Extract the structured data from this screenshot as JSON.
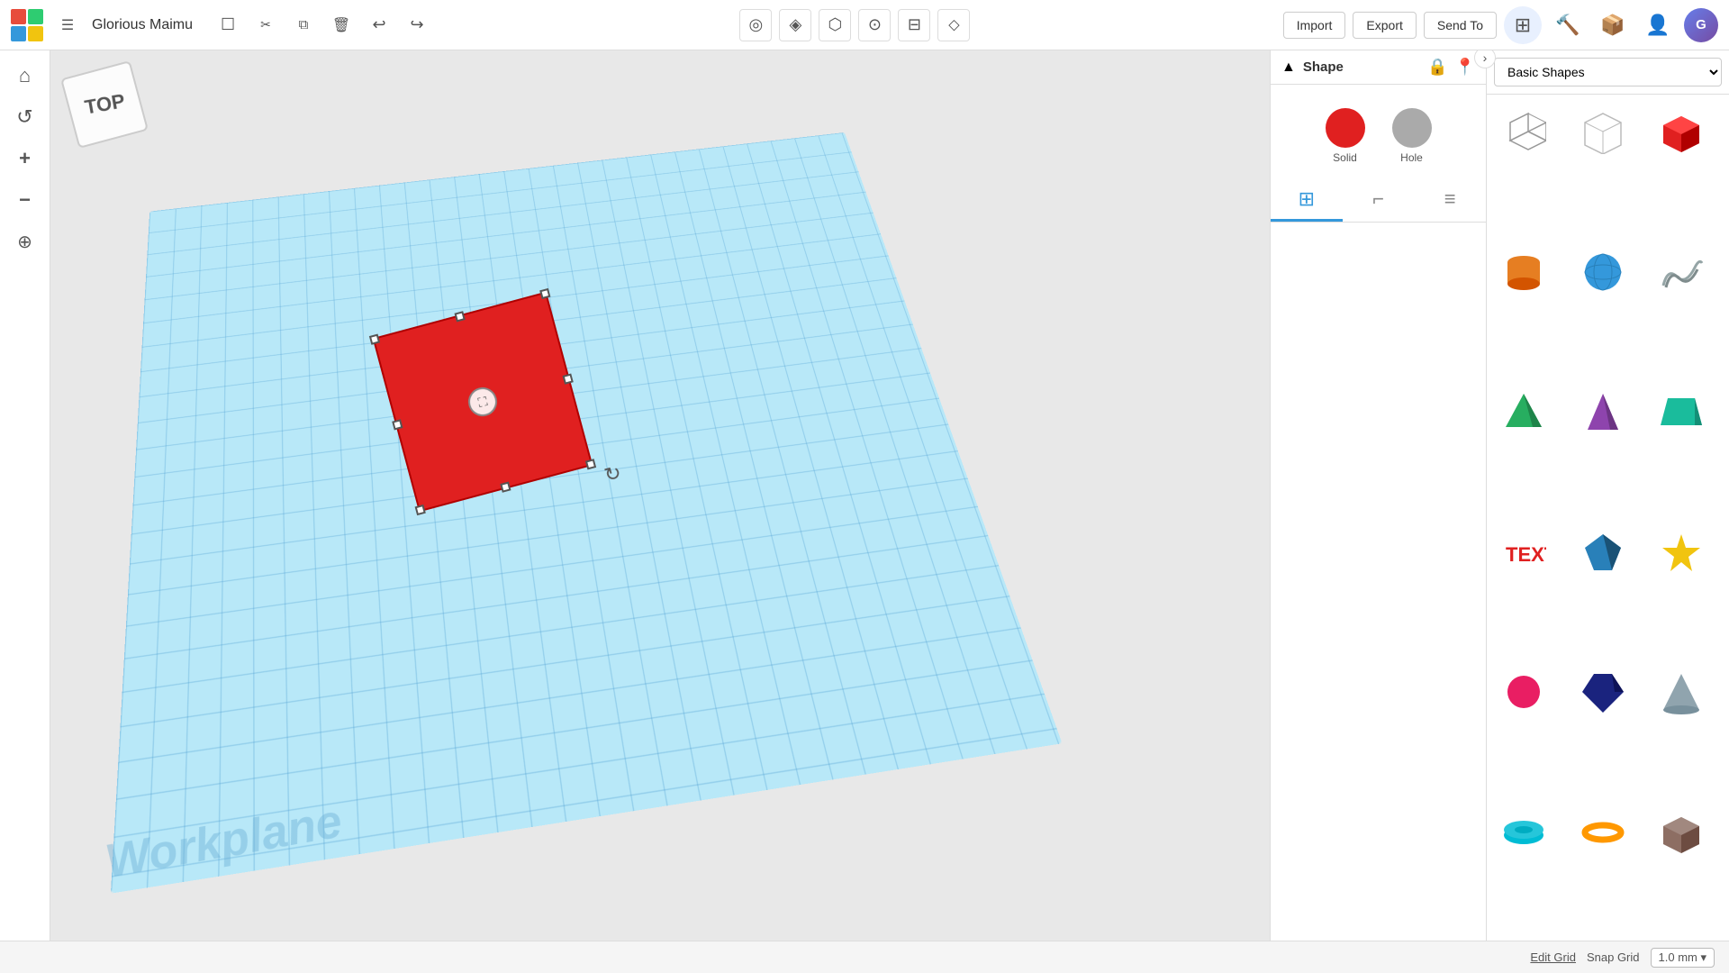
{
  "app": {
    "title": "Glorious Maimu",
    "logo_squares": [
      "r",
      "g",
      "b",
      "y"
    ]
  },
  "toolbar": {
    "new_label": "☐",
    "cut_label": "✂",
    "duplicate_label": "⧉",
    "delete_label": "🗑",
    "undo_label": "↩",
    "redo_label": "↪",
    "center_tools": [
      {
        "id": "snap",
        "icon": "◎"
      },
      {
        "id": "geoloc",
        "icon": "📍"
      },
      {
        "id": "select",
        "icon": "⬡"
      },
      {
        "id": "measure",
        "icon": "⊙"
      },
      {
        "id": "align",
        "icon": "⊟"
      },
      {
        "id": "mirror",
        "icon": "⬦"
      }
    ],
    "import_label": "Import",
    "export_label": "Export",
    "send_to_label": "Send To",
    "nav_icons": [
      {
        "id": "grid",
        "icon": "⊞",
        "active": true
      },
      {
        "id": "tools",
        "icon": "🔨"
      },
      {
        "id": "shapes",
        "icon": "📦"
      },
      {
        "id": "add-user",
        "icon": "👤+"
      }
    ]
  },
  "left_sidebar": {
    "buttons": [
      {
        "id": "home",
        "icon": "⌂"
      },
      {
        "id": "rotate",
        "icon": "↺"
      },
      {
        "id": "zoom-in",
        "icon": "+"
      },
      {
        "id": "zoom-out",
        "icon": "−"
      },
      {
        "id": "settings",
        "icon": "⚙"
      }
    ]
  },
  "view_indicator": {
    "label": "TOP"
  },
  "workplane": {
    "label": "Workplane"
  },
  "shape_panel": {
    "title": "Shape",
    "solid_label": "Solid",
    "hole_label": "Hole"
  },
  "shapes_library": {
    "dropdown_label": "Basic Shapes",
    "panel_tabs": [
      {
        "id": "grid",
        "icon": "⊞",
        "active": true
      },
      {
        "id": "angle",
        "icon": "⌐"
      },
      {
        "id": "notes",
        "icon": "≡"
      }
    ],
    "shapes": [
      {
        "id": "box-wire",
        "label": "box-wire",
        "color": "#aaa"
      },
      {
        "id": "box-wire2",
        "label": "box-wire2",
        "color": "#bbb"
      },
      {
        "id": "box-solid",
        "label": "box-solid",
        "color": "#e02020"
      },
      {
        "id": "cylinder",
        "label": "cylinder",
        "color": "#e67e22"
      },
      {
        "id": "sphere",
        "label": "sphere",
        "color": "#3498db"
      },
      {
        "id": "spiral",
        "label": "spiral",
        "color": "#95a5a6"
      },
      {
        "id": "pyramid-green",
        "label": "pyramid-green",
        "color": "#27ae60"
      },
      {
        "id": "pyramid-purple",
        "label": "pyramid-purple",
        "color": "#8e44ad"
      },
      {
        "id": "prism-teal",
        "label": "prism-teal",
        "color": "#1abc9c"
      },
      {
        "id": "text-red",
        "label": "text-red",
        "color": "#e02020"
      },
      {
        "id": "gem-blue",
        "label": "gem-blue",
        "color": "#2980b9"
      },
      {
        "id": "star-yellow",
        "label": "star-yellow",
        "color": "#f1c40f"
      },
      {
        "id": "blob-magenta",
        "label": "blob-magenta",
        "color": "#e91e63"
      },
      {
        "id": "gem2-navy",
        "label": "gem2-navy",
        "color": "#1a237e"
      },
      {
        "id": "cone-gray",
        "label": "cone-gray",
        "color": "#90a4ae"
      },
      {
        "id": "disc-cyan",
        "label": "disc-cyan",
        "color": "#00bcd4"
      },
      {
        "id": "torus-orange",
        "label": "torus-orange",
        "color": "#ff9800"
      },
      {
        "id": "box-brown",
        "label": "box-brown",
        "color": "#8d6e63"
      }
    ]
  },
  "bottombar": {
    "edit_grid_label": "Edit Grid",
    "snap_grid_label": "Snap Grid",
    "snap_grid_value": "1.0 mm ▾"
  }
}
